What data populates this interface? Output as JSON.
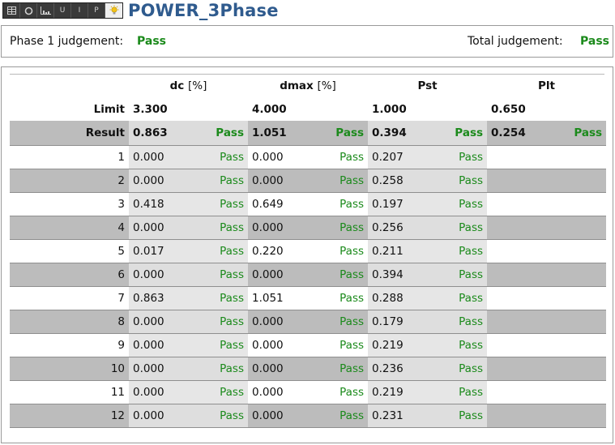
{
  "app": {
    "title": "POWER_3Phase",
    "toolbar_icons": [
      "table-icon",
      "circle-icon",
      "bar-chart-icon",
      "voltage-icon",
      "current-icon",
      "power-icon",
      "lightbulb-icon"
    ],
    "toolbar_glyphs": {
      "voltage": "U",
      "current": "I",
      "power": "P"
    }
  },
  "judgement": {
    "phase_label": "Phase 1 judgement:",
    "phase_value": "Pass",
    "total_label": "Total judgement:",
    "total_value": "Pass"
  },
  "table": {
    "columns": [
      {
        "name": "dc",
        "unit": "[%]"
      },
      {
        "name": "dmax",
        "unit": "[%]"
      },
      {
        "name": "Pst",
        "unit": ""
      },
      {
        "name": "Plt",
        "unit": ""
      }
    ],
    "limit": {
      "label": "Limit",
      "values": [
        "3.300",
        "4.000",
        "1.000",
        "0.650"
      ]
    },
    "result": {
      "label": "Result",
      "values": [
        "0.863",
        "1.051",
        "0.394",
        "0.254"
      ],
      "judgements": [
        "Pass",
        "Pass",
        "Pass",
        "Pass"
      ]
    },
    "rows": [
      {
        "index": "1",
        "dc": "0.000",
        "dc_j": "Pass",
        "dmax": "0.000",
        "dmax_j": "Pass",
        "pst": "0.207",
        "pst_j": "Pass"
      },
      {
        "index": "2",
        "dc": "0.000",
        "dc_j": "Pass",
        "dmax": "0.000",
        "dmax_j": "Pass",
        "pst": "0.258",
        "pst_j": "Pass"
      },
      {
        "index": "3",
        "dc": "0.418",
        "dc_j": "Pass",
        "dmax": "0.649",
        "dmax_j": "Pass",
        "pst": "0.197",
        "pst_j": "Pass"
      },
      {
        "index": "4",
        "dc": "0.000",
        "dc_j": "Pass",
        "dmax": "0.000",
        "dmax_j": "Pass",
        "pst": "0.256",
        "pst_j": "Pass"
      },
      {
        "index": "5",
        "dc": "0.017",
        "dc_j": "Pass",
        "dmax": "0.220",
        "dmax_j": "Pass",
        "pst": "0.211",
        "pst_j": "Pass"
      },
      {
        "index": "6",
        "dc": "0.000",
        "dc_j": "Pass",
        "dmax": "0.000",
        "dmax_j": "Pass",
        "pst": "0.394",
        "pst_j": "Pass"
      },
      {
        "index": "7",
        "dc": "0.863",
        "dc_j": "Pass",
        "dmax": "1.051",
        "dmax_j": "Pass",
        "pst": "0.288",
        "pst_j": "Pass"
      },
      {
        "index": "8",
        "dc": "0.000",
        "dc_j": "Pass",
        "dmax": "0.000",
        "dmax_j": "Pass",
        "pst": "0.179",
        "pst_j": "Pass"
      },
      {
        "index": "9",
        "dc": "0.000",
        "dc_j": "Pass",
        "dmax": "0.000",
        "dmax_j": "Pass",
        "pst": "0.219",
        "pst_j": "Pass"
      },
      {
        "index": "10",
        "dc": "0.000",
        "dc_j": "Pass",
        "dmax": "0.000",
        "dmax_j": "Pass",
        "pst": "0.236",
        "pst_j": "Pass"
      },
      {
        "index": "11",
        "dc": "0.000",
        "dc_j": "Pass",
        "dmax": "0.000",
        "dmax_j": "Pass",
        "pst": "0.219",
        "pst_j": "Pass"
      },
      {
        "index": "12",
        "dc": "0.000",
        "dc_j": "Pass",
        "dmax": "0.000",
        "dmax_j": "Pass",
        "pst": "0.231",
        "pst_j": "Pass"
      }
    ]
  },
  "colors": {
    "title": "#2f5b8e",
    "pass": "#1b8a1b",
    "row_dark": "#bcbcbc",
    "row_light": "#e6e6e6"
  }
}
